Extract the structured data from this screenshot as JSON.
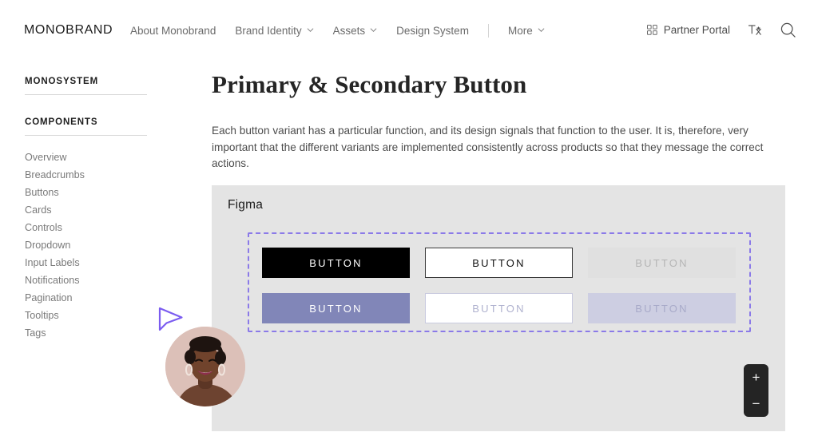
{
  "header": {
    "logo": "MONOBRAND",
    "nav": [
      {
        "label": "About Monobrand",
        "has_chevron": false
      },
      {
        "label": "Brand Identity",
        "has_chevron": true
      },
      {
        "label": "Assets",
        "has_chevron": true
      },
      {
        "label": "Design System",
        "has_chevron": false
      },
      {
        "label": "More",
        "has_chevron": true
      }
    ],
    "portal_label": "Partner Portal",
    "icons": {
      "grid": "grid-icon",
      "translate": "translate-icon",
      "search": "search-icon",
      "chevron": "chevron-down-icon"
    }
  },
  "sidebar": {
    "system_heading": "MONOSYSTEM",
    "components_heading": "COMPONENTS",
    "items": [
      {
        "label": "Overview"
      },
      {
        "label": "Breadcrumbs"
      },
      {
        "label": "Buttons"
      },
      {
        "label": "Cards"
      },
      {
        "label": "Controls"
      },
      {
        "label": "Dropdown"
      },
      {
        "label": "Input Labels"
      },
      {
        "label": "Notifications"
      },
      {
        "label": "Pagination"
      },
      {
        "label": "Tooltips"
      },
      {
        "label": "Tags"
      }
    ]
  },
  "main": {
    "title": "Primary & Secondary Button",
    "description": "Each button variant has a particular function, and its design signals that function to the user. It is, therefore, very important that the different variants are implemented consistently across products so that they message the correct actions."
  },
  "panel": {
    "title": "Figma",
    "buttons": [
      {
        "label": "BUTTON",
        "variant": "primary"
      },
      {
        "label": "BUTTON",
        "variant": "secondary"
      },
      {
        "label": "BUTTON",
        "variant": "disabled"
      },
      {
        "label": "BUTTON",
        "variant": "purple"
      },
      {
        "label": "BUTTON",
        "variant": "purple-outline"
      },
      {
        "label": "BUTTON",
        "variant": "purple-disabled"
      }
    ],
    "zoom_in": "+",
    "zoom_out": "−"
  },
  "colors": {
    "panel_bg": "#e4e4e4",
    "selection_border": "#8b7ae8",
    "cursor": "#7b5cf0",
    "primary": "#000000",
    "purple": "#8186b8",
    "purple_disabled": "#cdcee2",
    "disabled": "#e0e0e0",
    "avatar_bg": "#dbbcb4"
  }
}
